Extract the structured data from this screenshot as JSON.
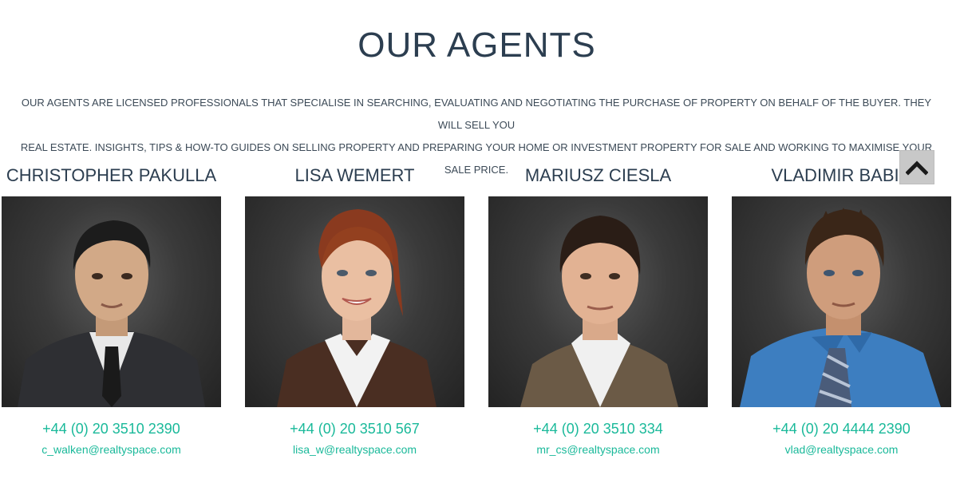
{
  "section": {
    "title": "OUR AGENTS",
    "intro_line1": "OUR AGENTS ARE LICENSED PROFESSIONALS THAT SPECIALISE IN SEARCHING, EVALUATING AND NEGOTIATING THE PURCHASE OF PROPERTY ON BEHALF OF THE BUYER. THEY WILL SELL YOU",
    "intro_line2": "REAL ESTATE. INSIGHTS, TIPS & HOW-TO GUIDES ON SELLING PROPERTY AND PREPARING YOUR HOME OR INVESTMENT PROPERTY FOR SALE AND WORKING TO MAXIMISE YOUR SALE PRICE."
  },
  "agents": [
    {
      "name": "CHRISTOPHER PAKULLA",
      "phone": "+44 (0) 20 3510 2390",
      "email": "c_walken@realtyspace.com"
    },
    {
      "name": "LISA WEMERT",
      "phone": "+44 (0) 20 3510 567",
      "email": "lisa_w@realtyspace.com"
    },
    {
      "name": "MARIUSZ CIESLA",
      "phone": "+44 (0) 20 3510 334",
      "email": "mr_cs@realtyspace.com"
    },
    {
      "name": "VLADIMIR BABIC",
      "phone": "+44 (0) 20 4444 2390",
      "email": "vlad@realtyspace.com"
    }
  ],
  "scroll_top": {
    "icon": "chevron-up-icon"
  },
  "colors": {
    "accent": "#1ab99a",
    "heading": "#2c3e50"
  }
}
